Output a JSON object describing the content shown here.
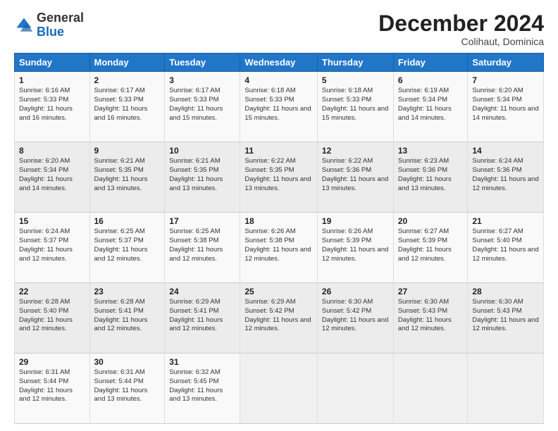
{
  "logo": {
    "general": "General",
    "blue": "Blue"
  },
  "header": {
    "month": "December 2024",
    "location": "Colihaut, Dominica"
  },
  "weekdays": [
    "Sunday",
    "Monday",
    "Tuesday",
    "Wednesday",
    "Thursday",
    "Friday",
    "Saturday"
  ],
  "weeks": [
    [
      {
        "day": "1",
        "sunrise": "6:16 AM",
        "sunset": "5:33 PM",
        "daylight": "11 hours and 16 minutes."
      },
      {
        "day": "2",
        "sunrise": "6:17 AM",
        "sunset": "5:33 PM",
        "daylight": "11 hours and 16 minutes."
      },
      {
        "day": "3",
        "sunrise": "6:17 AM",
        "sunset": "5:33 PM",
        "daylight": "11 hours and 15 minutes."
      },
      {
        "day": "4",
        "sunrise": "6:18 AM",
        "sunset": "5:33 PM",
        "daylight": "11 hours and 15 minutes."
      },
      {
        "day": "5",
        "sunrise": "6:18 AM",
        "sunset": "5:33 PM",
        "daylight": "11 hours and 15 minutes."
      },
      {
        "day": "6",
        "sunrise": "6:19 AM",
        "sunset": "5:34 PM",
        "daylight": "11 hours and 14 minutes."
      },
      {
        "day": "7",
        "sunrise": "6:20 AM",
        "sunset": "5:34 PM",
        "daylight": "11 hours and 14 minutes."
      }
    ],
    [
      {
        "day": "8",
        "sunrise": "6:20 AM",
        "sunset": "5:34 PM",
        "daylight": "11 hours and 14 minutes."
      },
      {
        "day": "9",
        "sunrise": "6:21 AM",
        "sunset": "5:35 PM",
        "daylight": "11 hours and 13 minutes."
      },
      {
        "day": "10",
        "sunrise": "6:21 AM",
        "sunset": "5:35 PM",
        "daylight": "11 hours and 13 minutes."
      },
      {
        "day": "11",
        "sunrise": "6:22 AM",
        "sunset": "5:35 PM",
        "daylight": "11 hours and 13 minutes."
      },
      {
        "day": "12",
        "sunrise": "6:22 AM",
        "sunset": "5:36 PM",
        "daylight": "11 hours and 13 minutes."
      },
      {
        "day": "13",
        "sunrise": "6:23 AM",
        "sunset": "5:36 PM",
        "daylight": "11 hours and 13 minutes."
      },
      {
        "day": "14",
        "sunrise": "6:24 AM",
        "sunset": "5:36 PM",
        "daylight": "11 hours and 12 minutes."
      }
    ],
    [
      {
        "day": "15",
        "sunrise": "6:24 AM",
        "sunset": "5:37 PM",
        "daylight": "11 hours and 12 minutes."
      },
      {
        "day": "16",
        "sunrise": "6:25 AM",
        "sunset": "5:37 PM",
        "daylight": "11 hours and 12 minutes."
      },
      {
        "day": "17",
        "sunrise": "6:25 AM",
        "sunset": "5:38 PM",
        "daylight": "11 hours and 12 minutes."
      },
      {
        "day": "18",
        "sunrise": "6:26 AM",
        "sunset": "5:38 PM",
        "daylight": "11 hours and 12 minutes."
      },
      {
        "day": "19",
        "sunrise": "6:26 AM",
        "sunset": "5:39 PM",
        "daylight": "11 hours and 12 minutes."
      },
      {
        "day": "20",
        "sunrise": "6:27 AM",
        "sunset": "5:39 PM",
        "daylight": "11 hours and 12 minutes."
      },
      {
        "day": "21",
        "sunrise": "6:27 AM",
        "sunset": "5:40 PM",
        "daylight": "11 hours and 12 minutes."
      }
    ],
    [
      {
        "day": "22",
        "sunrise": "6:28 AM",
        "sunset": "5:40 PM",
        "daylight": "11 hours and 12 minutes."
      },
      {
        "day": "23",
        "sunrise": "6:28 AM",
        "sunset": "5:41 PM",
        "daylight": "11 hours and 12 minutes."
      },
      {
        "day": "24",
        "sunrise": "6:29 AM",
        "sunset": "5:41 PM",
        "daylight": "11 hours and 12 minutes."
      },
      {
        "day": "25",
        "sunrise": "6:29 AM",
        "sunset": "5:42 PM",
        "daylight": "11 hours and 12 minutes."
      },
      {
        "day": "26",
        "sunrise": "6:30 AM",
        "sunset": "5:42 PM",
        "daylight": "11 hours and 12 minutes."
      },
      {
        "day": "27",
        "sunrise": "6:30 AM",
        "sunset": "5:43 PM",
        "daylight": "11 hours and 12 minutes."
      },
      {
        "day": "28",
        "sunrise": "6:30 AM",
        "sunset": "5:43 PM",
        "daylight": "11 hours and 12 minutes."
      }
    ],
    [
      {
        "day": "29",
        "sunrise": "6:31 AM",
        "sunset": "5:44 PM",
        "daylight": "11 hours and 12 minutes."
      },
      {
        "day": "30",
        "sunrise": "6:31 AM",
        "sunset": "5:44 PM",
        "daylight": "11 hours and 13 minutes."
      },
      {
        "day": "31",
        "sunrise": "6:32 AM",
        "sunset": "5:45 PM",
        "daylight": "11 hours and 13 minutes."
      },
      null,
      null,
      null,
      null
    ]
  ]
}
